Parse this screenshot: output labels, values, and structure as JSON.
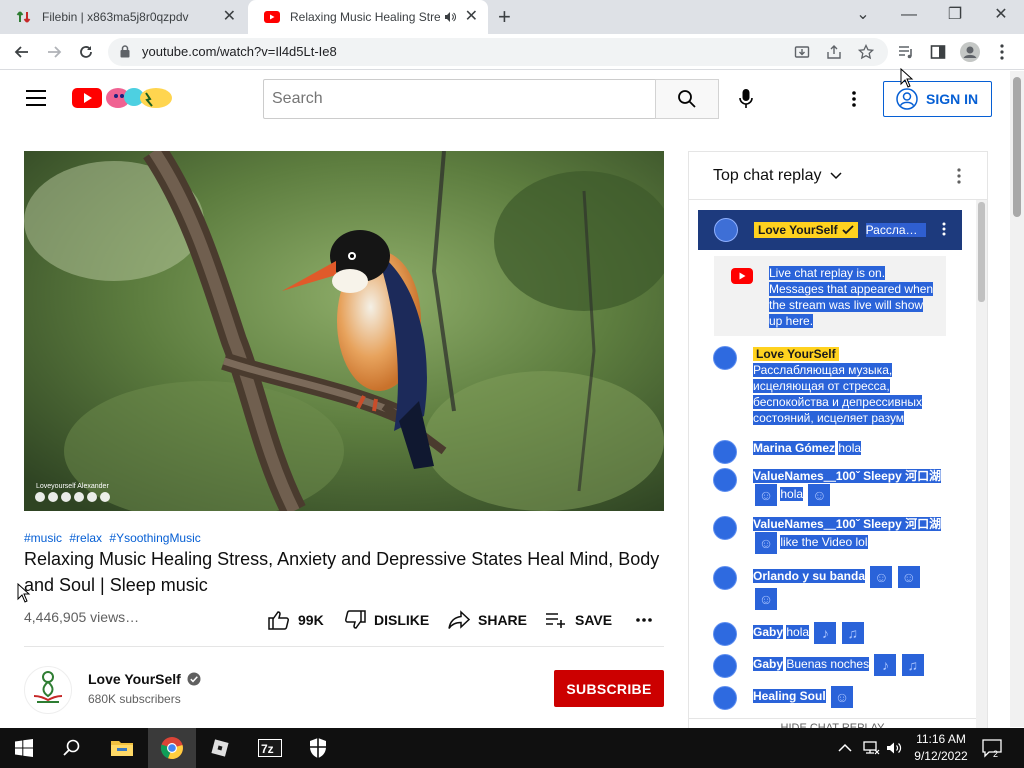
{
  "browser": {
    "tabs": [
      {
        "title": "Filebin | x863ma5j8r0qzpdv",
        "active": false
      },
      {
        "title": "Relaxing Music Healing Stress, Anxiety",
        "active": true
      }
    ],
    "url": "youtube.com/watch?v=Il4d5Lt-Ie8",
    "accent": "#dee1e6"
  },
  "youtube": {
    "search_placeholder": "Search",
    "sign_in": "SIGN IN"
  },
  "video": {
    "hashtags": [
      "#music",
      "#relax",
      "#YsoothingMusic"
    ],
    "title": "Relaxing Music Healing Stress, Anxiety and Depressive States Heal Mind, Body and Soul | Sleep music",
    "views": "4,446,905 views…",
    "watermark": "Loveyourself Alexander",
    "likes": "99K",
    "dislike": "DISLIKE",
    "share": "SHARE",
    "save": "SAVE"
  },
  "channel": {
    "name": "Love YourSelf",
    "subscribers": "680K subscribers",
    "subscribe": "SUBSCRIBE",
    "brand_color": "#cc0000"
  },
  "chat": {
    "header": "Top chat replay",
    "pinned": {
      "author": "Love YourSelf",
      "text": "Рассла…"
    },
    "live_notice": "Live chat replay is on. Messages that appeared when the stream was live will show up here.",
    "messages": [
      {
        "author": "Love YourSelf",
        "text": "Расслабляющая музыка, исцеляющая от стресса, беспокойства и депрессивных состояний, исцеляет разум"
      },
      {
        "author": "Marina Gómez",
        "text": "hola"
      },
      {
        "author": "ValueNames＿100ˇ Sleepy 河口湖",
        "text": "hola"
      },
      {
        "author": "ValueNames＿100ˇ Sleepy 河口湖",
        "text": "like the Video lol"
      },
      {
        "author": "Orlando y su banda",
        "text": ""
      },
      {
        "author": "Gaby",
        "text": "hola"
      },
      {
        "author": "Gaby",
        "text": "Buenas noches"
      },
      {
        "author": "Healing Soul",
        "text": ""
      }
    ],
    "footer": "HIDE CHAT REPLAY"
  },
  "taskbar": {
    "time": "11:16 AM",
    "date": "9/12/2022",
    "notification_count": "2",
    "apps": [
      "start-icon",
      "search-icon",
      "file-explorer-icon",
      "chrome-icon",
      "roblox-icon",
      "7zip-icon",
      "defender-icon"
    ]
  }
}
